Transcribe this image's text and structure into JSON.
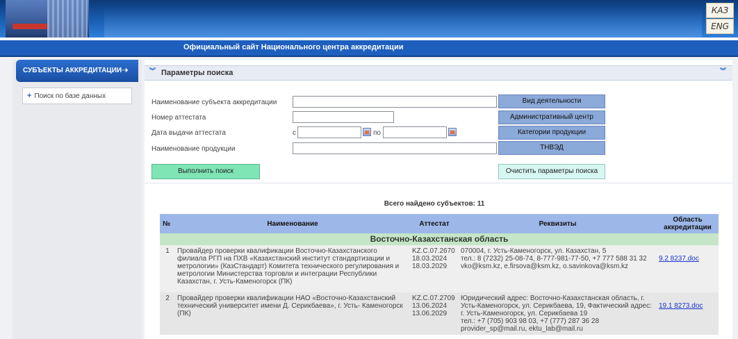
{
  "lang": {
    "kz": "КАЗ",
    "en": "ENG"
  },
  "header": {
    "title": "Официальный сайт Национального центра аккредитации"
  },
  "sidebar": {
    "section_title": "СУБЪЕКТЫ АККРЕДИТАЦИИ",
    "items": [
      {
        "label": "Поиск по базе данных"
      }
    ]
  },
  "search": {
    "panel_title": "Параметры поиска",
    "fields": {
      "name_label": "Наименование субъекта аккредитации",
      "cert_label": "Номер аттестата",
      "date_label": "Дата выдачи аттестата",
      "date_from": "с",
      "date_to": "по",
      "product_label": "Наименование продукции",
      "name_value": "",
      "cert_value": "",
      "date_from_value": "",
      "date_to_value": "",
      "product_value": ""
    },
    "filter_buttons": [
      "Вид деятельности",
      "Административный центр",
      "Категории продукции",
      "ТНВЭД"
    ],
    "run_label": "Выполнить поиск",
    "clear_label": "Очистить параметры поиска"
  },
  "results": {
    "total_label": "Всего найдено субъектов: 11",
    "columns": [
      "№",
      "Наименование",
      "Аттестат",
      "Реквизиты",
      "Область аккредитации"
    ],
    "region": "Восточно-Казахстанская область",
    "rows": [
      {
        "num": "1",
        "name": "Провайдер проверки квалификации Восточно-Казахстанского филиала РГП на ПХВ «Казахстанский институт стандартизации и метрологии» (КазСтандарт) Комитета технического регулирования и метрологии Министерства торговли и интеграции Республики Казахстан, г. Усть-Каменогорск (ПК)",
        "cert": "KZ.C.07.2670",
        "date1": "18.03.2024",
        "date2": "18.03.2029",
        "details": "070004, г. Усть-Каменогорск, ул. Казахстан, 5\nтел.: 8 (7232) 25-08-74, 8-777-981-77-50, +7 777 588 31 32\nvko@ksm.kz, e.firsova@ksm.kz, o.savinkova@ksm.kz",
        "doc": "9.2 8237.doc"
      },
      {
        "num": "2",
        "name": "Провайдер проверки квалификации НАО «Восточно-Казахстанский технический университет имени Д. Серикбаева», г. Усть- Каменогорск (ПК)",
        "cert": "KZ.C.07.2709",
        "date1": "13.06.2024",
        "date2": "13.06.2029",
        "details": "Юридический адрес: Восточно-Казахстанская область, г. Усть-Каменогорск, ул. Серикбаева, 19, Фактический адрес: г. Усть-Каменогорск, ул. Серикбаева 19\nтел.: +7 (705) 903 98 03, +7 (777) 287 36 28\nprovider_sp@mail.ru, ektu_lab@mail.ru",
        "doc": "19.1 8273.doc"
      }
    ]
  },
  "colors": {
    "title_bar": "#1e5fbe",
    "filter_button": "#8ba9d9",
    "run_button": "#7fe5b5",
    "clear_button": "#d7f7f2",
    "table_header": "#9db8e8",
    "region_row": "#c4e6c6"
  }
}
